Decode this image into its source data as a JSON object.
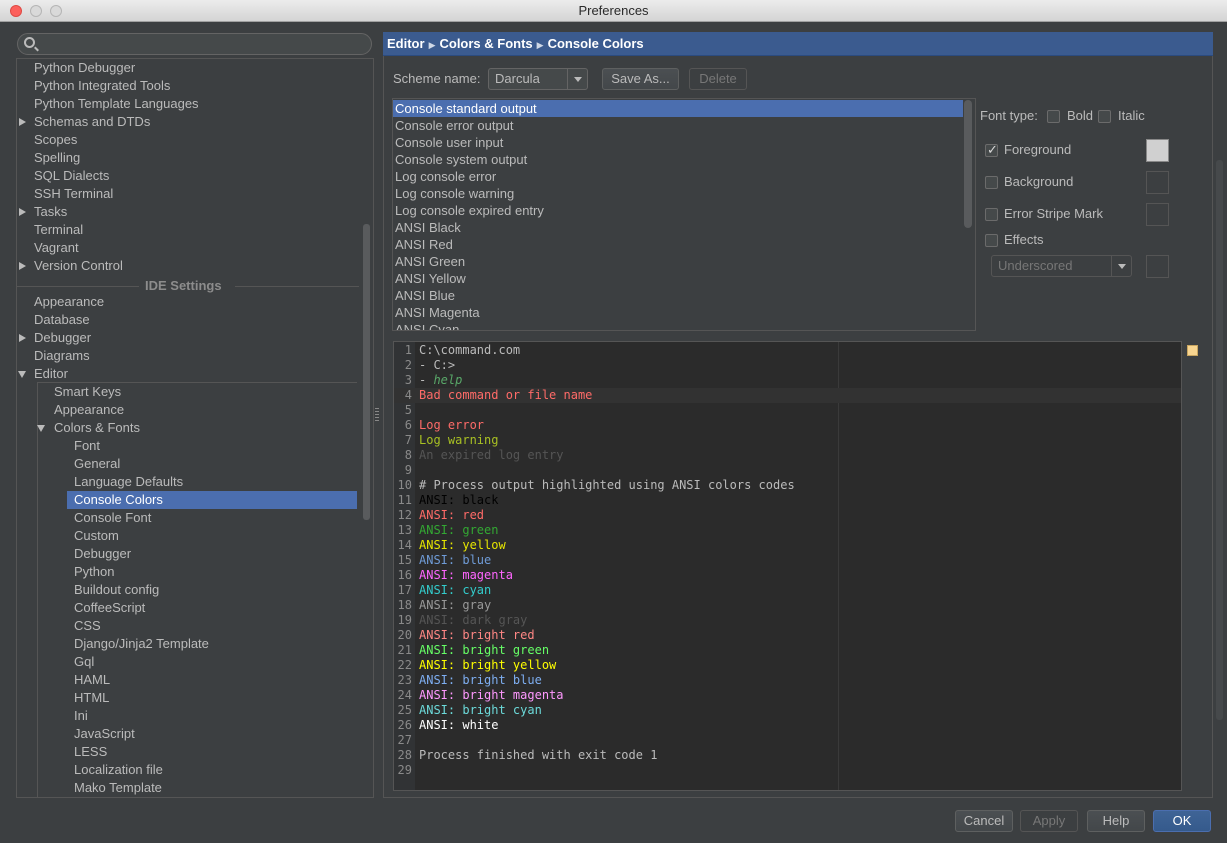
{
  "window": {
    "title": "Preferences"
  },
  "search": {
    "placeholder": ""
  },
  "sidebar": {
    "items": [
      {
        "label": "Python Debugger",
        "arrow": ""
      },
      {
        "label": "Python Integrated Tools",
        "arrow": ""
      },
      {
        "label": "Python Template Languages",
        "arrow": ""
      },
      {
        "label": "Schemas and DTDs",
        "arrow": "right"
      },
      {
        "label": "Scopes",
        "arrow": ""
      },
      {
        "label": "Spelling",
        "arrow": ""
      },
      {
        "label": "SQL Dialects",
        "arrow": ""
      },
      {
        "label": "SSH Terminal",
        "arrow": ""
      },
      {
        "label": "Tasks",
        "arrow": "right"
      },
      {
        "label": "Terminal",
        "arrow": ""
      },
      {
        "label": "Vagrant",
        "arrow": ""
      },
      {
        "label": "Version Control",
        "arrow": "right"
      }
    ],
    "section_label": "IDE Settings",
    "ide_items": [
      {
        "label": "Appearance",
        "arrow": ""
      },
      {
        "label": "Database",
        "arrow": ""
      },
      {
        "label": "Debugger",
        "arrow": "right"
      },
      {
        "label": "Diagrams",
        "arrow": ""
      },
      {
        "label": "Editor",
        "arrow": "down"
      }
    ],
    "editor_items": [
      {
        "label": "Smart Keys",
        "arrow": ""
      },
      {
        "label": "Appearance",
        "arrow": ""
      },
      {
        "label": "Colors & Fonts",
        "arrow": "down"
      }
    ],
    "colors_items": [
      "Font",
      "General",
      "Language Defaults",
      "Console Colors",
      "Console Font",
      "Custom",
      "Debugger",
      "Python",
      "Buildout config",
      "CoffeeScript",
      "CSS",
      "Django/Jinja2 Template",
      "Gql",
      "HAML",
      "HTML",
      "Ini",
      "JavaScript",
      "LESS",
      "Localization file",
      "Mako Template"
    ],
    "selected": "Console Colors"
  },
  "breadcrumb": {
    "part1": "Editor",
    "part2": "Colors & Fonts",
    "part3": "Console Colors"
  },
  "scheme": {
    "label": "Scheme name:",
    "value": "Darcula",
    "save_as": "Save As...",
    "delete": "Delete"
  },
  "attributes": [
    "Console standard output",
    "Console error output",
    "Console user input",
    "Console system output",
    "Log console error",
    "Log console warning",
    "Log console expired entry",
    "ANSI Black",
    "ANSI Red",
    "ANSI Green",
    "ANSI Yellow",
    "ANSI Blue",
    "ANSI Magenta",
    "ANSI Cyan"
  ],
  "options": {
    "font_type": "Font type:",
    "bold": "Bold",
    "italic": "Italic",
    "foreground": "Foreground",
    "background": "Background",
    "error_stripe": "Error Stripe Mark",
    "effects": "Effects",
    "effect_type": "Underscored",
    "foreground_checked": true
  },
  "preview_lines": [
    {
      "n": "1",
      "segs": [
        {
          "t": "C:\\command.com",
          "c": "#bbbbbb"
        }
      ]
    },
    {
      "n": "2",
      "segs": [
        {
          "t": "- C:>",
          "c": "#bbbbbb"
        }
      ]
    },
    {
      "n": "3",
      "segs": [
        {
          "t": "- ",
          "c": "#bbbbbb"
        },
        {
          "t": "help",
          "c": "#59a869",
          "i": true
        }
      ]
    },
    {
      "n": "4",
      "hl": true,
      "segs": [
        {
          "t": "Bad command or file name",
          "c": "#ff6b68"
        }
      ]
    },
    {
      "n": "5",
      "segs": []
    },
    {
      "n": "6",
      "segs": [
        {
          "t": "Log error",
          "c": "#ff6b68"
        }
      ]
    },
    {
      "n": "7",
      "segs": [
        {
          "t": "Log warning",
          "c": "#a8c023"
        }
      ]
    },
    {
      "n": "8",
      "segs": [
        {
          "t": "An expired log entry",
          "c": "#555555"
        }
      ]
    },
    {
      "n": "9",
      "segs": []
    },
    {
      "n": "10",
      "segs": [
        {
          "t": "# Process output highlighted using ANSI colors codes",
          "c": "#bbbbbb"
        }
      ]
    },
    {
      "n": "11",
      "segs": [
        {
          "t": "ANSI: ",
          "c": "#000000"
        },
        {
          "t": "black",
          "c": "#000000"
        }
      ]
    },
    {
      "n": "12",
      "segs": [
        {
          "t": "ANSI: ",
          "c": "#ff6b68"
        },
        {
          "t": "red",
          "c": "#ff6b68"
        }
      ]
    },
    {
      "n": "13",
      "segs": [
        {
          "t": "ANSI: ",
          "c": "#33a833"
        },
        {
          "t": "green",
          "c": "#33a833"
        }
      ]
    },
    {
      "n": "14",
      "segs": [
        {
          "t": "ANSI: ",
          "c": "#e6e600"
        },
        {
          "t": "yellow",
          "c": "#e6e600"
        }
      ]
    },
    {
      "n": "15",
      "segs": [
        {
          "t": "ANSI: ",
          "c": "#6f9bd6"
        },
        {
          "t": "blue",
          "c": "#6f9bd6"
        }
      ]
    },
    {
      "n": "16",
      "segs": [
        {
          "t": "ANSI: ",
          "c": "#ff66ff"
        },
        {
          "t": "magenta",
          "c": "#ff66ff"
        }
      ]
    },
    {
      "n": "17",
      "segs": [
        {
          "t": "ANSI: ",
          "c": "#33cccc"
        },
        {
          "t": "cyan",
          "c": "#33cccc"
        }
      ]
    },
    {
      "n": "18",
      "segs": [
        {
          "t": "ANSI: ",
          "c": "#999999"
        },
        {
          "t": "gray",
          "c": "#999999"
        }
      ]
    },
    {
      "n": "19",
      "segs": [
        {
          "t": "ANSI: ",
          "c": "#555555"
        },
        {
          "t": "dark gray",
          "c": "#555555"
        }
      ]
    },
    {
      "n": "20",
      "segs": [
        {
          "t": "ANSI: ",
          "c": "#ff8785"
        },
        {
          "t": "bright red",
          "c": "#ff8785"
        }
      ]
    },
    {
      "n": "21",
      "segs": [
        {
          "t": "ANSI: ",
          "c": "#66ff66"
        },
        {
          "t": "bright green",
          "c": "#66ff66"
        }
      ]
    },
    {
      "n": "22",
      "segs": [
        {
          "t": "ANSI: ",
          "c": "#ffff00"
        },
        {
          "t": "bright yellow",
          "c": "#ffff00"
        }
      ]
    },
    {
      "n": "23",
      "segs": [
        {
          "t": "ANSI: ",
          "c": "#7eaef1"
        },
        {
          "t": "bright blue",
          "c": "#7eaef1"
        }
      ]
    },
    {
      "n": "24",
      "segs": [
        {
          "t": "ANSI: ",
          "c": "#ff99ff"
        },
        {
          "t": "bright magenta",
          "c": "#ff99ff"
        }
      ]
    },
    {
      "n": "25",
      "segs": [
        {
          "t": "ANSI: ",
          "c": "#6cdada"
        },
        {
          "t": "bright cyan",
          "c": "#6cdada"
        }
      ]
    },
    {
      "n": "26",
      "segs": [
        {
          "t": "ANSI: ",
          "c": "#ffffff"
        },
        {
          "t": "white",
          "c": "#ffffff"
        }
      ]
    },
    {
      "n": "27",
      "segs": []
    },
    {
      "n": "28",
      "segs": [
        {
          "t": "Process finished with exit code 1",
          "c": "#bbbbbb"
        }
      ]
    },
    {
      "n": "29",
      "segs": []
    }
  ],
  "buttons": {
    "cancel": "Cancel",
    "apply": "Apply",
    "help": "Help",
    "ok": "OK"
  },
  "colors": {
    "selection": "#4b6eaf",
    "panel_bg": "#3c3f41",
    "editor_bg": "#2b2b2b",
    "header_bg": "#3b5b8f"
  }
}
